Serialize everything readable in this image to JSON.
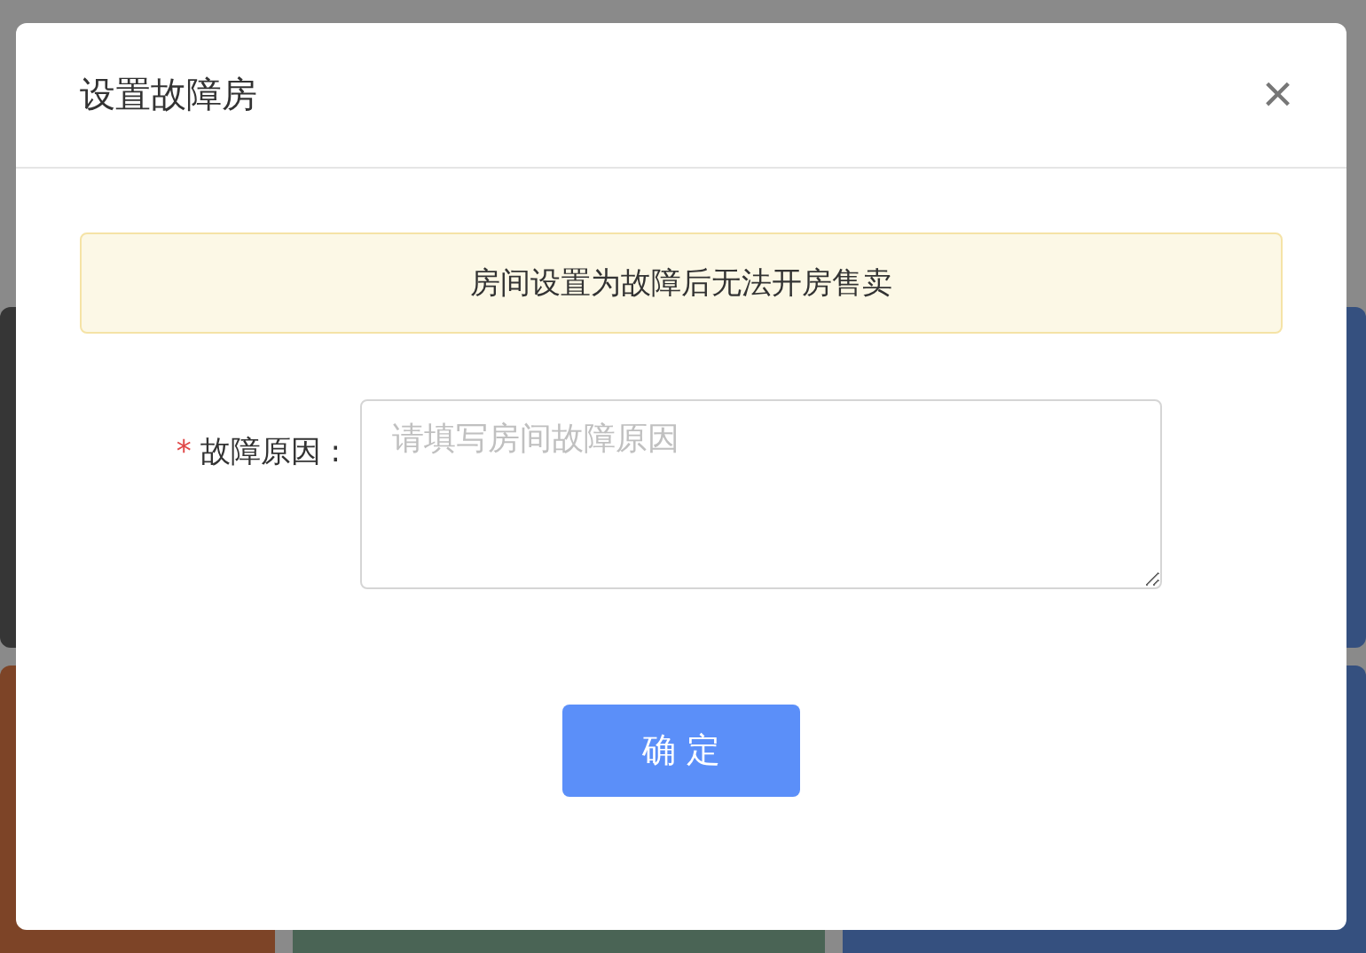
{
  "dialog": {
    "title": "设置故障房",
    "close": "×",
    "alert": "房间设置为故障后无法开房售卖",
    "field": {
      "label": "故障原因 :",
      "required": true,
      "required_mark": "*",
      "placeholder": "请填写房间故障原因"
    },
    "button": "确 定"
  }
}
